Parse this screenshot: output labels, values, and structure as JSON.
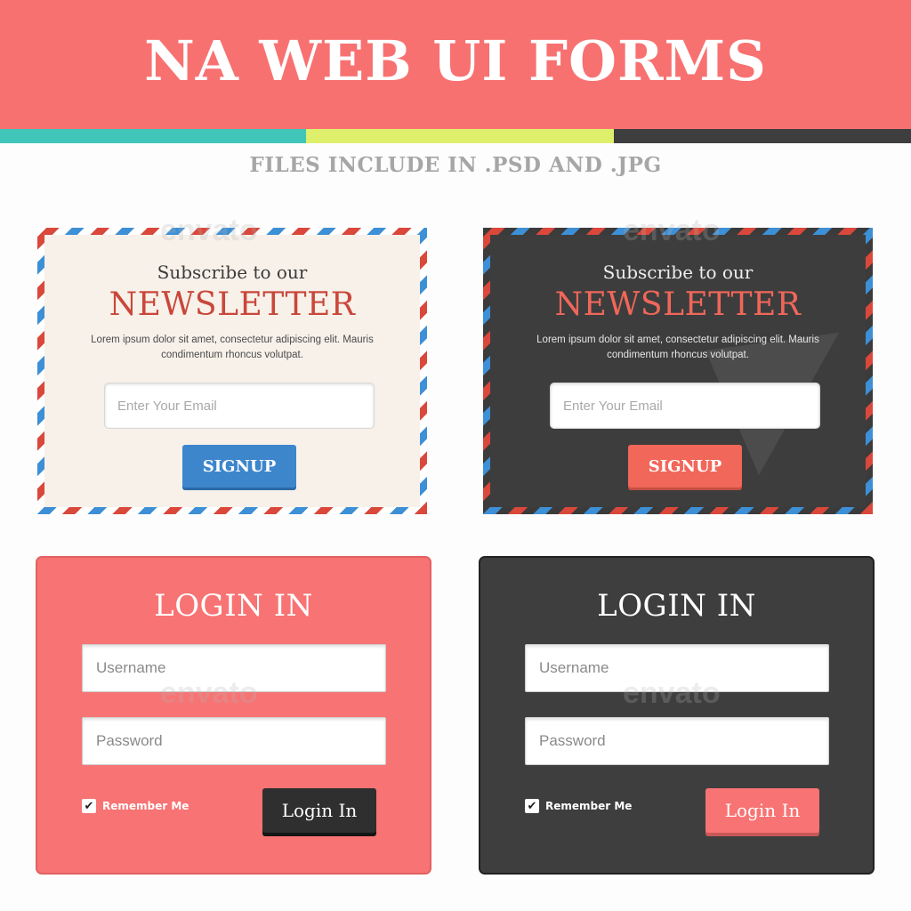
{
  "header": {
    "title": "NA WEB UI FORMS",
    "subtitle": "FILES INCLUDE IN .PSD AND .JPG",
    "colors": [
      "#3fc6b8",
      "#def06b",
      "#3e3e3e"
    ]
  },
  "newsletter_light": {
    "sub_heading": "Subscribe to our",
    "heading": "NEWSLETTER",
    "description": "Lorem ipsum dolor sit amet, consectetur adipiscing elit. Mauris condimentum rhoncus volutpat.",
    "email_placeholder": "Enter Your Email",
    "signup_label": "SIGNUP",
    "button_color": "#3d86cc"
  },
  "newsletter_dark": {
    "sub_heading": "Subscribe to our",
    "heading": "NEWSLETTER",
    "description": "Lorem ipsum dolor sit amet, consectetur adipiscing elit. Mauris condimentum rhoncus volutpat.",
    "email_placeholder": "Enter Your Email",
    "signup_label": "SIGNUP",
    "button_color": "#f1675a"
  },
  "login_pink": {
    "title": "LOGIN IN",
    "username_placeholder": "Username",
    "password_placeholder": "Password",
    "remember_label": "Remember Me",
    "remember_checked": true,
    "button_label": "Login In"
  },
  "login_dark": {
    "title": "LOGIN IN",
    "username_placeholder": "Username",
    "password_placeholder": "Password",
    "remember_label": "Remember Me",
    "remember_checked": true,
    "button_label": "Login In"
  },
  "watermark": "envato"
}
